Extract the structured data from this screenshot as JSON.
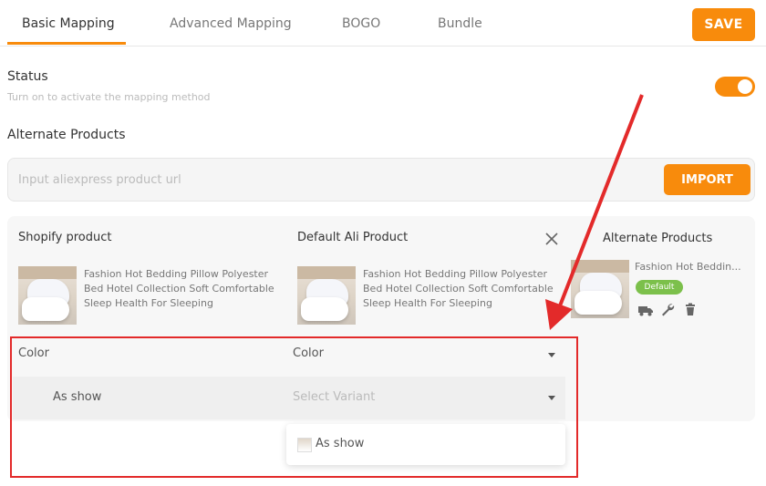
{
  "tabs": [
    {
      "label": "Basic Mapping"
    },
    {
      "label": "Advanced Mapping"
    },
    {
      "label": "BOGO"
    },
    {
      "label": "Bundle"
    }
  ],
  "toolbar": {
    "save_label": "SAVE"
  },
  "status": {
    "label": "Status",
    "hint": "Turn on to activate the mapping method",
    "enabled": true
  },
  "alternate": {
    "section_label": "Alternate Products",
    "url_placeholder": "Input aliexpress product url",
    "import_label": "IMPORT"
  },
  "mapping": {
    "col_shopify": "Shopify product",
    "col_default": "Default Ali Product",
    "col_alternate": "Alternate Products",
    "shopify_title": "Fashion Hot Bedding Pillow Polyester Bed Hotel Collection Soft Comfortable Sleep Health For Sleeping",
    "default_title": "Fashion Hot Bedding Pillow Polyester Bed Hotel Collection Soft Comfortable Sleep Health For Sleeping",
    "alternate_title": "Fashion Hot Beddin...",
    "default_badge": "Default",
    "option_left": "Color",
    "option_right": "Color",
    "variant_value": "As show",
    "variant_select_placeholder": "Select Variant",
    "dropdown_option": "As show"
  },
  "colors": {
    "accent": "#f88b0c",
    "badge": "#7cc04b",
    "highlight": "#e32a2a"
  },
  "icons": [
    "close-icon",
    "truck-icon",
    "wrench-icon",
    "trash-icon",
    "caret-down-icon"
  ]
}
